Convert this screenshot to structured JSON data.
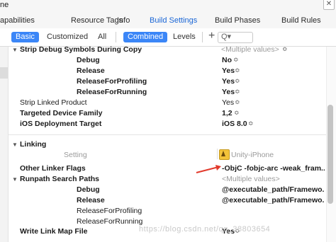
{
  "window": {
    "title_fragment": "ne",
    "close_glyph": "✕"
  },
  "tabs": [
    {
      "label": "apabilities"
    },
    {
      "label": "Resource Tags"
    },
    {
      "label": "Info"
    },
    {
      "label": "Build Settings"
    },
    {
      "label": "Build Phases"
    },
    {
      "label": "Build Rules"
    }
  ],
  "filter": {
    "basic": "Basic",
    "customized": "Customized",
    "all": "All",
    "combined": "Combined",
    "levels": "Levels",
    "add": "+",
    "search_glyph": "Q▾"
  },
  "sections": {
    "strip_debug": {
      "label": "Strip Debug Symbols During Copy",
      "value": "<Multiple values>",
      "rows": [
        {
          "label": "Debug",
          "value": "No"
        },
        {
          "label": "Release",
          "value": "Yes"
        },
        {
          "label": "ReleaseForProfiling",
          "value": "Yes"
        },
        {
          "label": "ReleaseForRunning",
          "value": "Yes"
        }
      ]
    },
    "strip_linked": {
      "label": "Strip Linked Product",
      "value": "Yes"
    },
    "target_family": {
      "label": "Targeted Device Family",
      "value": "1,2"
    },
    "deployment_target": {
      "label": "iOS Deployment Target",
      "value": "iOS 8.0"
    },
    "linking": {
      "label": "Linking",
      "setting_header": "Setting",
      "target_name": "Unity-iPhone",
      "other_linker_flags": {
        "label": "Other Linker Flags",
        "value": "-ObjC -fobjc-arc -weak_fram..."
      },
      "runpath": {
        "label": "Runpath Search Paths",
        "value": "<Multiple values>",
        "rows": [
          {
            "label": "Debug",
            "value": "@executable_path/Framewo..."
          },
          {
            "label": "Release",
            "value": "@executable_path/Framewo..."
          },
          {
            "label": "ReleaseForProfiling",
            "value": ""
          },
          {
            "label": "ReleaseForRunning",
            "value": ""
          }
        ]
      },
      "write_link_map": {
        "label": "Write Link Map File",
        "value": "Yes"
      }
    }
  },
  "glyphs": {
    "stepper": "≎",
    "stepper_alt": "◇",
    "triangle_down": "▼"
  },
  "watermark": "https://blog.csdn.net/qq_38803654",
  "colors": {
    "accent": "#3b86f7",
    "arrow": "#e23a2c",
    "tab_active": "#1a66d6"
  }
}
